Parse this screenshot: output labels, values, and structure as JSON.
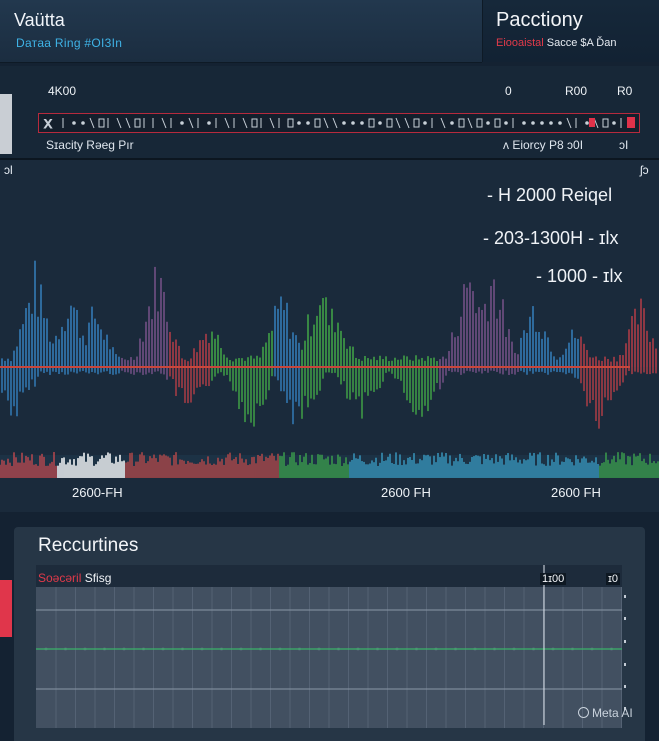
{
  "header": {
    "left_title": "Vaütta",
    "left_subtitle": "Dатаа Ring #OI3In",
    "right_title": "Pacctiony",
    "right_sub_red": "Eiooaistal",
    "right_sub_rest": " Sacce   $A Ďan"
  },
  "strip": {
    "val_left": "4K00",
    "val_zero": "0",
    "val_mid": "R00",
    "val_right": "R0",
    "caption_left": "Sɪacity Rəeg Pır",
    "caption_right": "ʌ Eiorcy P8 ɔ0I",
    "caption_far": "ɔI",
    "corner_left": "ɔl",
    "corner_right": "ʃɔ"
  },
  "chart": {
    "legend_1": "- H  2000 Reiqel",
    "legend_2": "- 203-1300H - ɪlx",
    "legend_3": "- 1000 - ɪlx",
    "xticks": [
      "2600-FH",
      "2600 FH",
      "2600 FH"
    ],
    "colors": {
      "blue": "#3a8fd6",
      "purple": "#8a5a9a",
      "red": "#d2424a",
      "green": "#4bbf4a",
      "cyan": "#3aa5d8",
      "axis": "#d24a3a"
    }
  },
  "recent": {
    "title": "Reccurtines",
    "label_red": "Soəcəril",
    "label_rest": " Sfisg",
    "val_1": "1ɪ00",
    "val_2": "ɪ0"
  },
  "watermark": "Meta AI"
}
